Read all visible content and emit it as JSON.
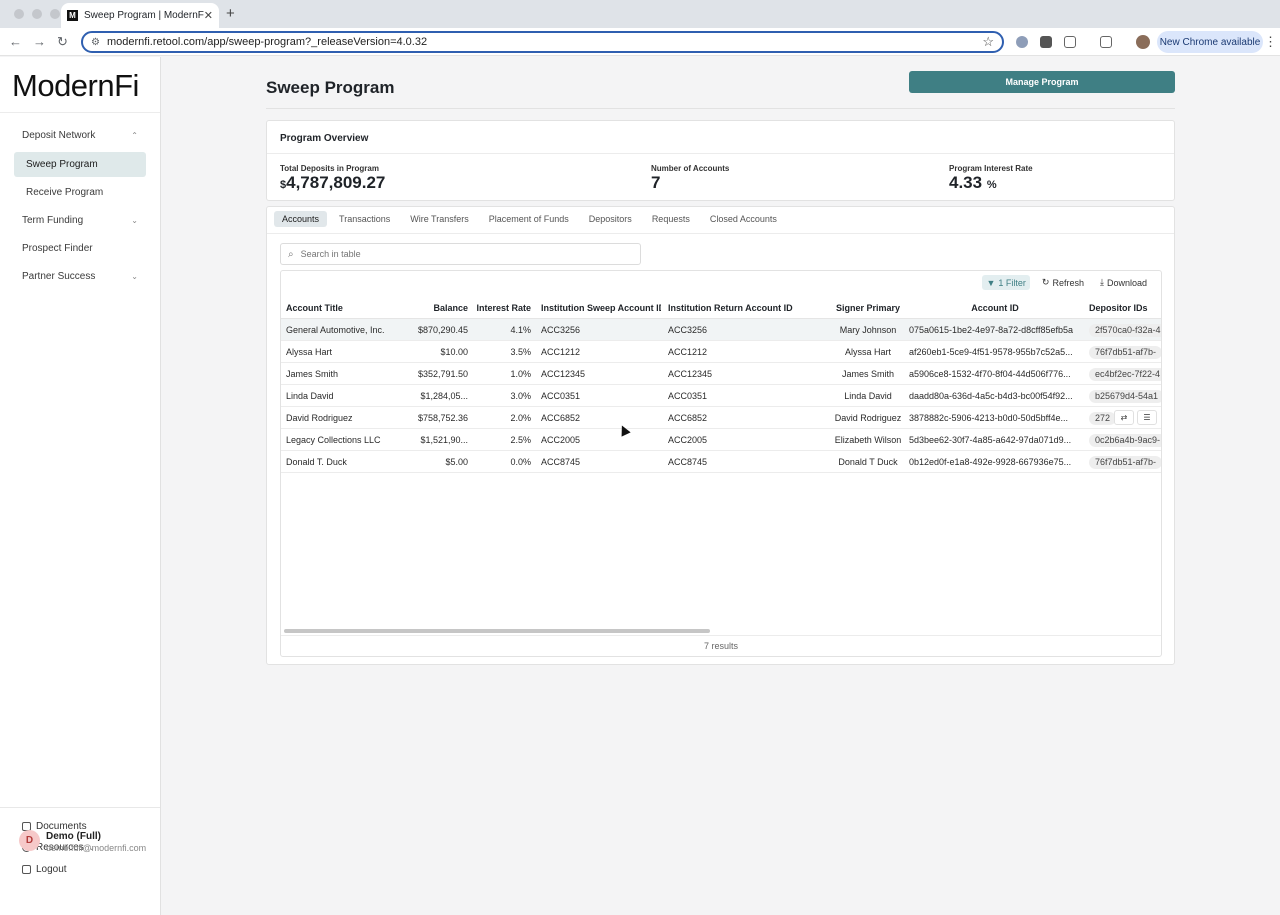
{
  "browser": {
    "tab_title": "Sweep Program | ModernFi",
    "tab_favicon": "M",
    "url": "modernfi.retool.com/app/sweep-program?_releaseVersion=4.0.32",
    "new_chrome_label": "New Chrome available"
  },
  "sidebar": {
    "logo": "ModernFi",
    "items": [
      {
        "label": "Deposit Network",
        "chevron": "⌃"
      },
      {
        "label": "Sweep Program"
      },
      {
        "label": "Receive Program"
      },
      {
        "label": "Term Funding",
        "chevron": "⌄"
      },
      {
        "label": "Prospect Finder"
      },
      {
        "label": "Partner Success",
        "chevron": "⌄"
      }
    ],
    "bottom": {
      "documents": "Documents",
      "resources": "Resources",
      "logout": "Logout"
    },
    "user": {
      "initial": "D",
      "name": "Demo (Full)",
      "email": "demo.full@modernfi.com"
    }
  },
  "page": {
    "title": "Sweep Program",
    "manage_button": "Manage Program"
  },
  "overview": {
    "title": "Program Overview",
    "total_label": "Total Deposits in Program",
    "total_currency": "$",
    "total_value": "4,787,809.27",
    "accounts_label": "Number of Accounts",
    "accounts_value": "7",
    "rate_label": "Program Interest Rate",
    "rate_value": "4.33",
    "rate_unit": "%"
  },
  "tabs": [
    "Accounts",
    "Transactions",
    "Wire Transfers",
    "Placement of Funds",
    "Depositors",
    "Requests",
    "Closed Accounts"
  ],
  "table": {
    "search_placeholder": "Search in table",
    "filter_label": "1 Filter",
    "refresh_label": "Refresh",
    "download_label": "Download",
    "columns": [
      "Account Title",
      "Balance",
      "Interest Rate",
      "Institution Sweep Account ID",
      "Institution Return Account ID",
      "Signer Primary",
      "Account ID",
      "Depositor IDs"
    ],
    "rows": [
      [
        "General Automotive, Inc.",
        "$870,290.45",
        "4.1%",
        "ACC3256",
        "ACC3256",
        "Mary Johnson",
        "075a0615-1be2-4e97-8a72-d8cff85efb5a",
        "2f570ca0-f32a-4"
      ],
      [
        "Alyssa Hart",
        "$10.00",
        "3.5%",
        "ACC1212",
        "ACC1212",
        "Alyssa Hart",
        "af260eb1-5ce9-4f51-9578-955b7c52a5...",
        "76f7db51-af7b-"
      ],
      [
        "James Smith",
        "$352,791.50",
        "1.0%",
        "ACC12345",
        "ACC12345",
        "James Smith",
        "a5906ce8-1532-4f70-8f04-44d506f776...",
        "ec4bf2ec-7f22-4"
      ],
      [
        "Linda David",
        "$1,284,05...",
        "3.0%",
        "ACC0351",
        "ACC0351",
        "Linda David",
        "daadd80a-636d-4a5c-b4d3-bc00f54f92...",
        "b25679d4-54a1"
      ],
      [
        "David Rodriguez",
        "$758,752.36",
        "2.0%",
        "ACC6852",
        "ACC6852",
        "David Rodriguez",
        "3878882c-5906-4213-b0d0-50d5bff4e...",
        "272"
      ],
      [
        "Legacy Collections LLC",
        "$1,521,90...",
        "2.5%",
        "ACC2005",
        "ACC2005",
        "Elizabeth Wilson",
        "5d3bee62-30f7-4a85-a642-97da071d9...",
        "0c2b6a4b-9ac9-"
      ],
      [
        "Donald T. Duck",
        "$5.00",
        "0.0%",
        "ACC8745",
        "ACC8745",
        "Donald T Duck",
        "0b12ed0f-e1a8-492e-9928-667936e75...",
        "76f7db51-af7b-"
      ]
    ],
    "results": "7 results"
  }
}
